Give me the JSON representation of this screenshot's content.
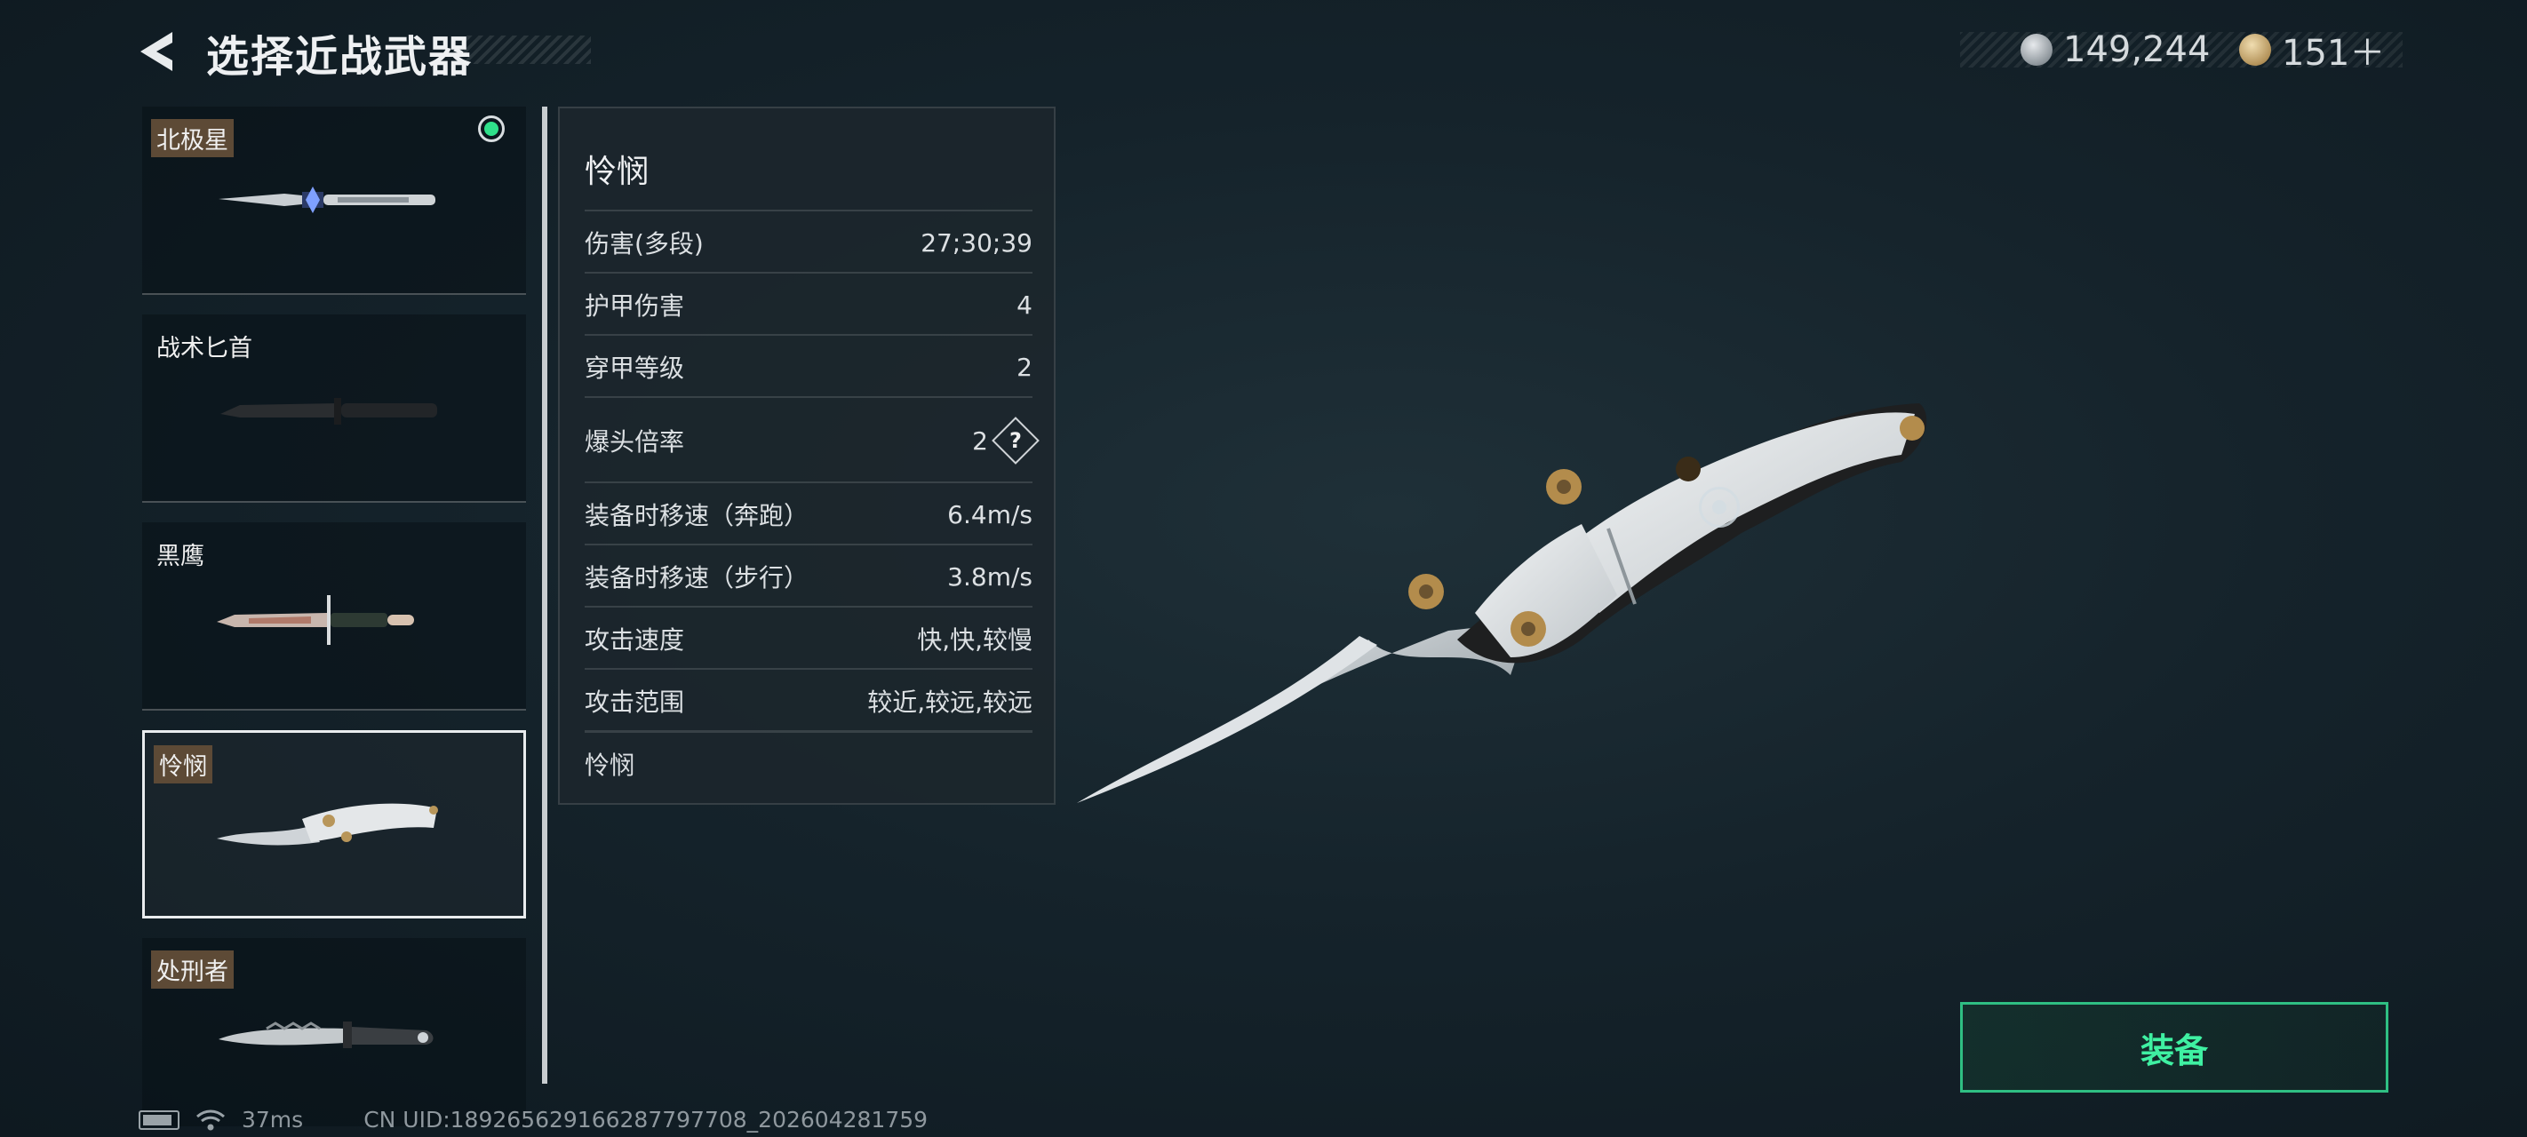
{
  "header": {
    "title": "选择近战武器"
  },
  "currency": [
    {
      "icon": "silver-coin-icon",
      "value": "149,244"
    },
    {
      "icon": "gold-coin-icon",
      "value": "151＋"
    }
  ],
  "weapons": [
    {
      "name": "北极星",
      "equipped": true
    },
    {
      "name": "战术匕首"
    },
    {
      "name": "黑鹰"
    },
    {
      "name": "怜悯",
      "selected": true
    },
    {
      "name": "处刑者"
    }
  ],
  "stats": {
    "title": "怜悯",
    "rows": [
      {
        "label": "伤害(多段)",
        "value": "27;30;39"
      },
      {
        "label": "护甲伤害",
        "value": "4"
      },
      {
        "label": "穿甲等级",
        "value": "2"
      },
      {
        "label": "爆头倍率",
        "value": "2"
      },
      {
        "label": "装备时移速（奔跑）",
        "value": "6.4m/s"
      },
      {
        "label": "装备时移速（步行）",
        "value": "3.8m/s"
      },
      {
        "label": "攻击速度",
        "value": "快,快,较慢"
      },
      {
        "label": "攻击范围",
        "value": "较近,较远,较远"
      }
    ],
    "description": "怜悯",
    "help_symbol": "?"
  },
  "equip_button": "装备",
  "footer": {
    "ping": "37ms",
    "uid": "CN UID:189265629166287797708_202604281759"
  },
  "colors": {
    "accent_green": "#3ff0a2",
    "equipped_dot": "#2fe08a",
    "name_tag": "#5d4a36"
  }
}
